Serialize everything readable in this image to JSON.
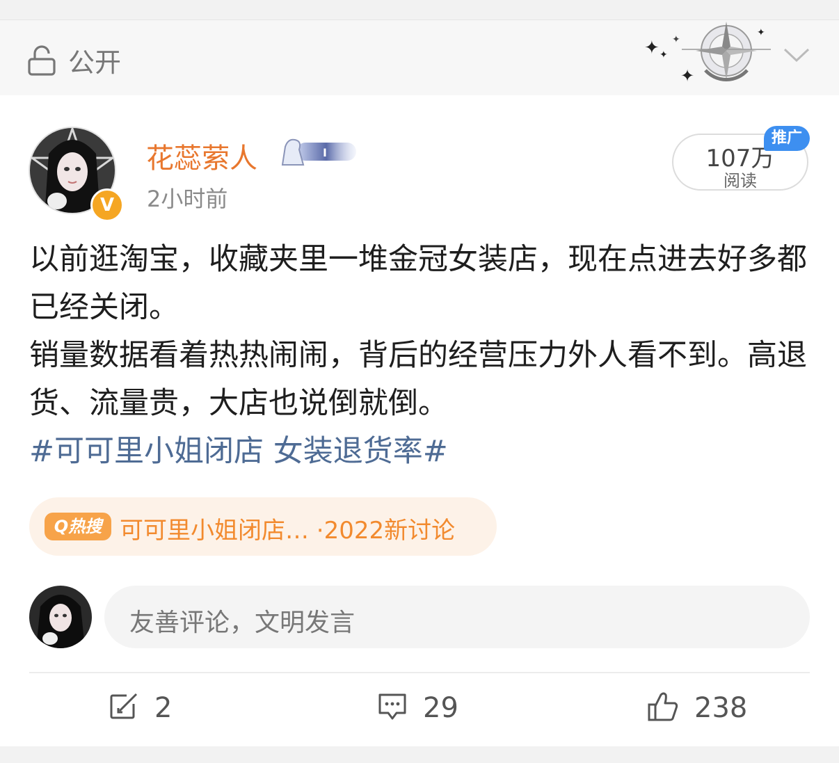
{
  "header": {
    "privacy_label": "公开",
    "icons": {
      "lock": "unlock-icon",
      "decoration": "compass-star-decoration",
      "expand": "chevron-down-icon"
    }
  },
  "post": {
    "username": "花蕊萦人",
    "time": "2小时前",
    "read_count": "107万",
    "read_label": "阅读",
    "promo_tag": "推广",
    "paragraphs": [
      "以前逛淘宝，收藏夹里一堆金冠女装店，现在点进去好多都已经关闭。",
      "销量数据看着热热闹闹，背后的经营压力外人看不到。高退货、流量贵，大店也说倒就倒。"
    ],
    "hashtags": "#可可里小姐闭店 女装退货率#",
    "verified_mark": "V"
  },
  "hot_search": {
    "badge": "Q热搜",
    "text": "可可里小姐闭店… ·2022新讨论"
  },
  "comment": {
    "placeholder": "友善评论，文明发言"
  },
  "actions": {
    "repost_count": "2",
    "comment_count": "29",
    "like_count": "238"
  },
  "colors": {
    "username": "#e8772e",
    "hashtag": "#4e6b94",
    "hot_text": "#f28a2e",
    "promo": "#3d8ff0"
  }
}
